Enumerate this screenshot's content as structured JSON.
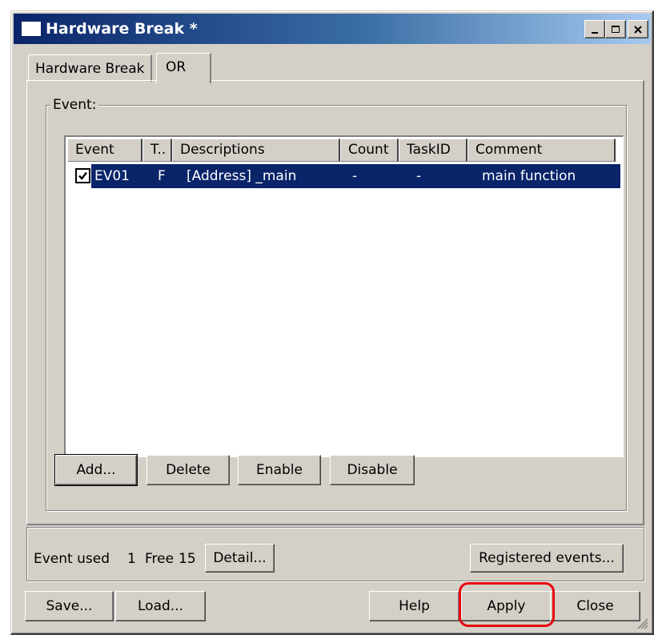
{
  "window": {
    "title": "Hardware Break *",
    "controls": {
      "minimize": "minimize-icon",
      "maximize": "maximize-icon",
      "close": "close-icon"
    }
  },
  "tabs": [
    {
      "label": "Hardware Break",
      "selected": false
    },
    {
      "label": "OR",
      "selected": true
    }
  ],
  "event_group": {
    "label": "Event:",
    "columns": [
      "Event",
      "T..",
      "Descriptions",
      "Count",
      "TaskID",
      "Comment"
    ],
    "rows": [
      {
        "checked": true,
        "event": "EV01",
        "type": "F",
        "description": "[Address] _main",
        "count": "-",
        "taskid": "-",
        "comment": "main function",
        "selected": true
      }
    ],
    "buttons": {
      "add": "Add...",
      "delete": "Delete",
      "enable": "Enable",
      "disable": "Disable"
    }
  },
  "status": {
    "event_used_label": "Event used",
    "event_used_value": "1",
    "free_label": "Free",
    "free_value": "15",
    "detail_button": "Detail...",
    "registered_button": "Registered events..."
  },
  "footer": {
    "save": "Save...",
    "load": "Load...",
    "help": "Help",
    "apply": "Apply",
    "close": "Close"
  },
  "colors": {
    "dialog_bg": "#d4d0c8",
    "selection": "#0a246a",
    "highlight_ring": "#e8000c"
  }
}
